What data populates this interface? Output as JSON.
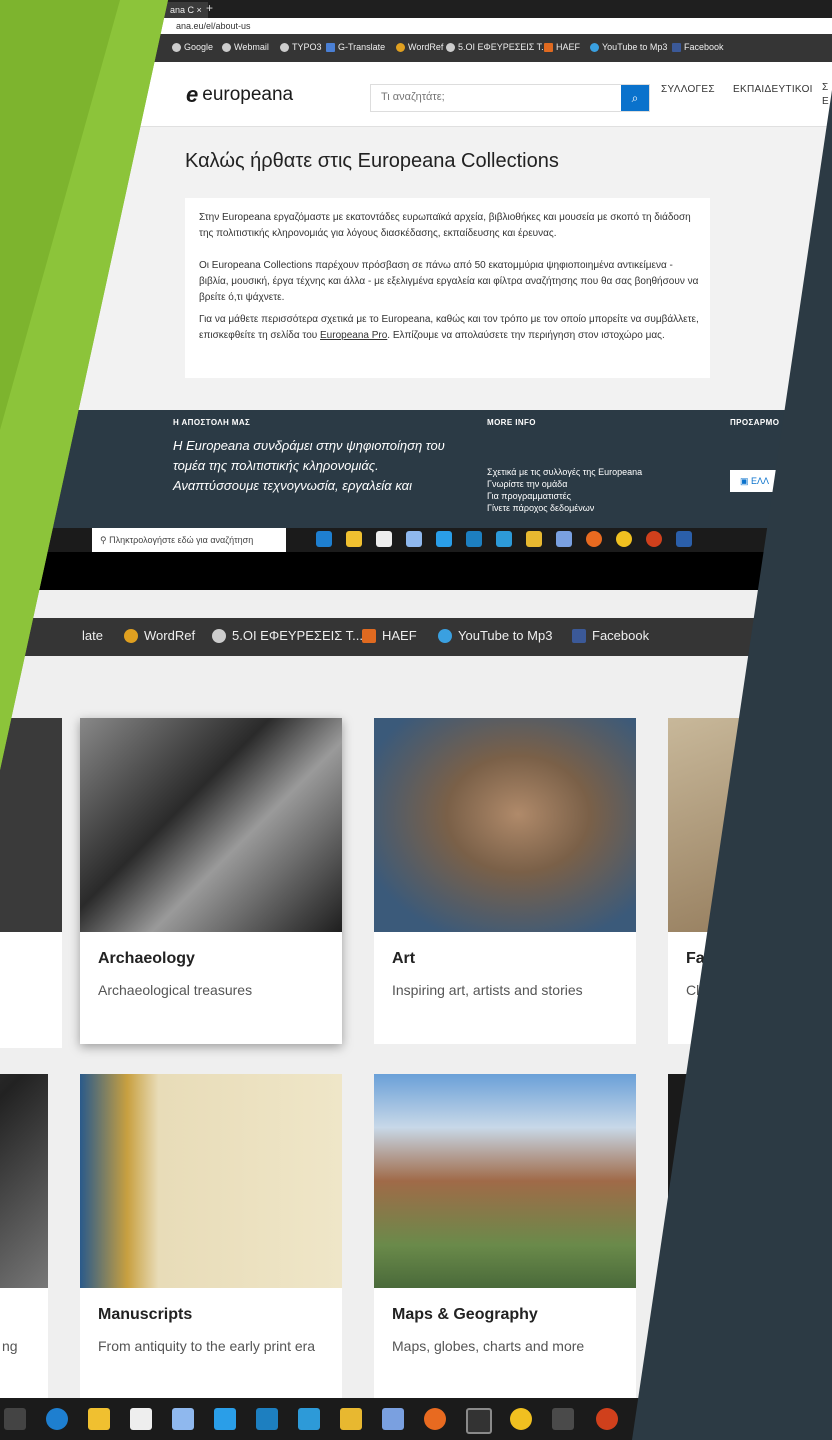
{
  "top": {
    "tab_title": "ana C",
    "tab_close": "×",
    "new_tab": "+",
    "url": "ana.eu/el/about-us",
    "bookmarks": [
      "Google",
      "Webmail",
      "TYPO3",
      "G-Translate",
      "WordRef",
      "5.ΟΙ ΕΦΕΥΡΕΣΕΙΣ Τ...",
      "HAEF",
      "YouTube to Mp3",
      "Facebook"
    ],
    "logo": "europeana",
    "search_placeholder": "Τι αναζητάτε;",
    "search_icon": "search-icon",
    "nav": [
      "ΣΥΛΛΟΓΕΣ",
      "ΕΚΠΑΙΔΕΥΤΙΚΟΙ",
      "Σ",
      "Ε"
    ],
    "welcome_title": "Καλώς ήρθατε στις Europeana Collections",
    "para1": "Στην Europeana εργαζόμαστε με εκατοντάδες ευρωπαϊκά αρχεία, βιβλιοθήκες και μουσεία με σκοπό τη διάδοση της πολιτιστικής κληρονομιάς για λόγους διασκέδασης, εκπαίδευσης και έρευνας.",
    "para2": "Οι Europeana Collections παρέχουν πρόσβαση σε πάνω από 50 εκατομμύρια ψηφιοποιημένα αντικείμενα - βιβλία, μουσική, έργα τέχνης και άλλα - με εξελιγμένα εργαλεία και φίλτρα αναζήτησης που θα σας βοηθήσουν να βρείτε ό,τι ψάχνετε.",
    "para3_a": "Για να μάθετε περισσότερα σχετικά με το Europeana, καθώς και τον τρόπο με τον οποίο μπορείτε να συμβάλλετε, επισκεφθείτε τη σελίδα του ",
    "para3_link": "Europeana Pro",
    "para3_b": ". Ελπίζουμε να απολαύσετε την περιήγηση στον ιστοχώρο μας.",
    "footer_h1": "Η ΑΠΟΣΤΟΛΗ ΜΑΣ",
    "footer_mission": "Η Europeana συνδράμει στην ψηφιοποίηση του τομέα της πολιτιστικής κληρονομιάς. Αναπτύσσουμε τεχνογνωσία, εργαλεία και",
    "footer_h2": "MORE INFO",
    "more_info": [
      "Σχετικά με τις συλλογές της Europeana",
      "Γνωρίστε την ομάδα",
      "Για προγραμματιστές",
      "Γίνετε πάροχος δεδομένων"
    ],
    "footer_h3": "ΠΡΟΣΑΡΜΟ",
    "lang_button": "ΕΛΛ",
    "win_search": "Πληκτρολογήστε εδώ για αναζήτηση"
  },
  "bottom": {
    "bookmarks": [
      "late",
      "WordRef",
      "5.ΟΙ ΕΦΕΥΡΕΣΕΙΣ Τ...",
      "HAEF",
      "YouTube to Mp3",
      "Facebook"
    ],
    "tiles": [
      {
        "title": "Archaeology",
        "desc": "Archaeological treasures"
      },
      {
        "title": "Art",
        "desc": "Inspiring art, artists and stories"
      },
      {
        "title": "Fa",
        "desc": "Cl"
      },
      {
        "title": "Manuscripts",
        "desc": "From antiquity to the early print era"
      },
      {
        "title": "Maps & Geography",
        "desc": "Maps, globes, charts and more"
      },
      {
        "title": "",
        "desc": "ng"
      }
    ]
  },
  "colors": {
    "green": "#7db42e",
    "dark_slate": "#2c3a44",
    "europeana_blue": "#0a72cc"
  }
}
